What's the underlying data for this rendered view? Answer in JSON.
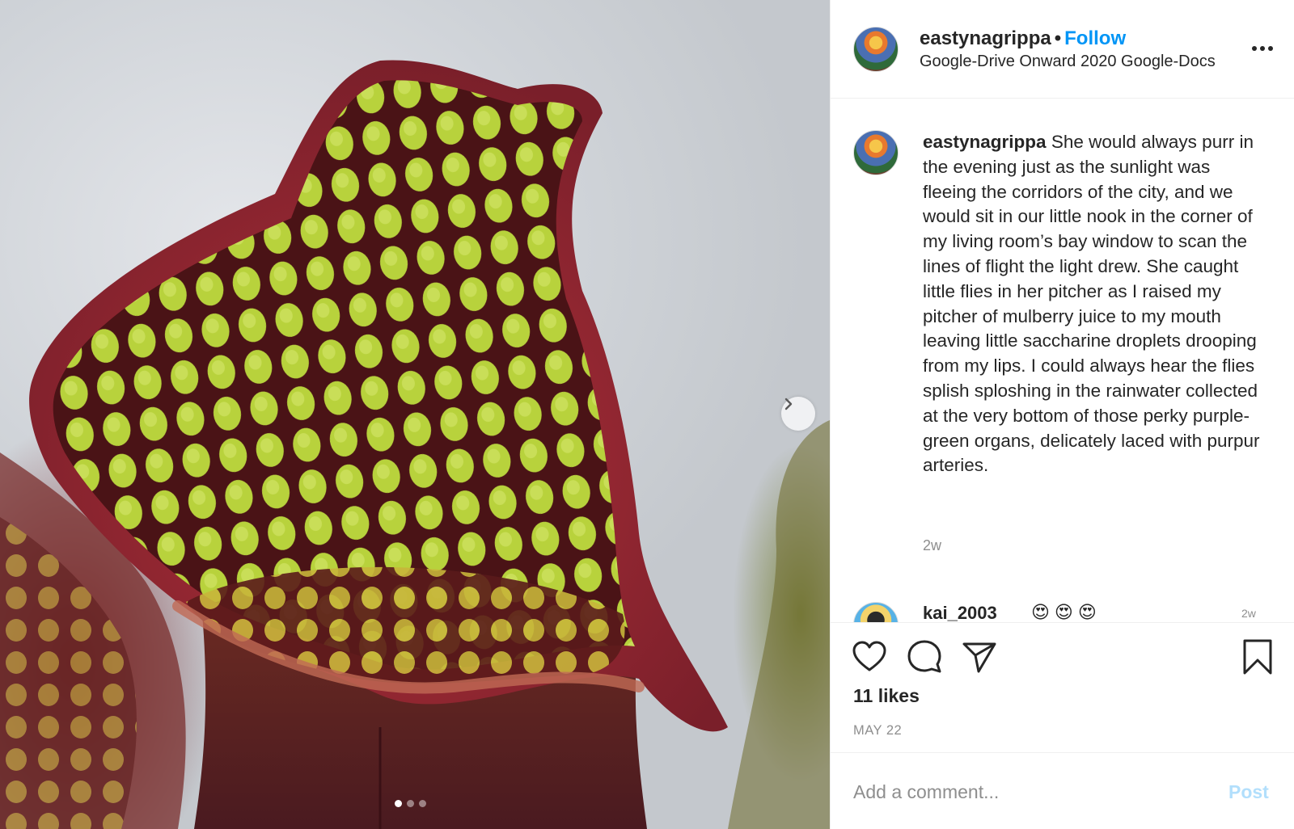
{
  "post": {
    "username": "eastynagrippa",
    "separator": "•",
    "follow_label": "Follow",
    "subtitle": "Google-Drive Onward 2020 Google-Docs",
    "caption_username": "eastynagrippa",
    "caption_text": "She would always purr in the evening just as the sunlight was fleeing the corridors of the city, and we would sit in our little nook in the corner of my living room’s bay window to scan the lines of flight the light drew. She caught little flies in her pitcher as I raised my pitcher of mulberry juice to my mouth leaving little saccharine droplets drooping from my lips. I could always hear the flies splish sploshing in the rainwater collected at the very bottom of those perky purple-green organs, delicately laced with purpur arteries.",
    "time_ago": "2w",
    "likes": "11 likes",
    "date": "MAY 22"
  },
  "comments": [
    {
      "username": "kai_2003",
      "text": "😍😍😍",
      "time": "2w"
    }
  ],
  "carousel": {
    "slide_count": 3,
    "active_index": 0
  },
  "composer": {
    "placeholder": "Add a comment...",
    "post_label": "Post"
  },
  "icons": {
    "next": "chevron-right-icon",
    "like": "heart-icon",
    "comment": "comment-bubble-icon",
    "share": "paper-plane-icon",
    "save": "bookmark-icon",
    "more": "more-options-icon"
  },
  "colors": {
    "follow_blue": "#0095f6",
    "post_disabled": "#b2dffc",
    "muted_text": "#8e8e8e",
    "divider": "#efefef"
  }
}
